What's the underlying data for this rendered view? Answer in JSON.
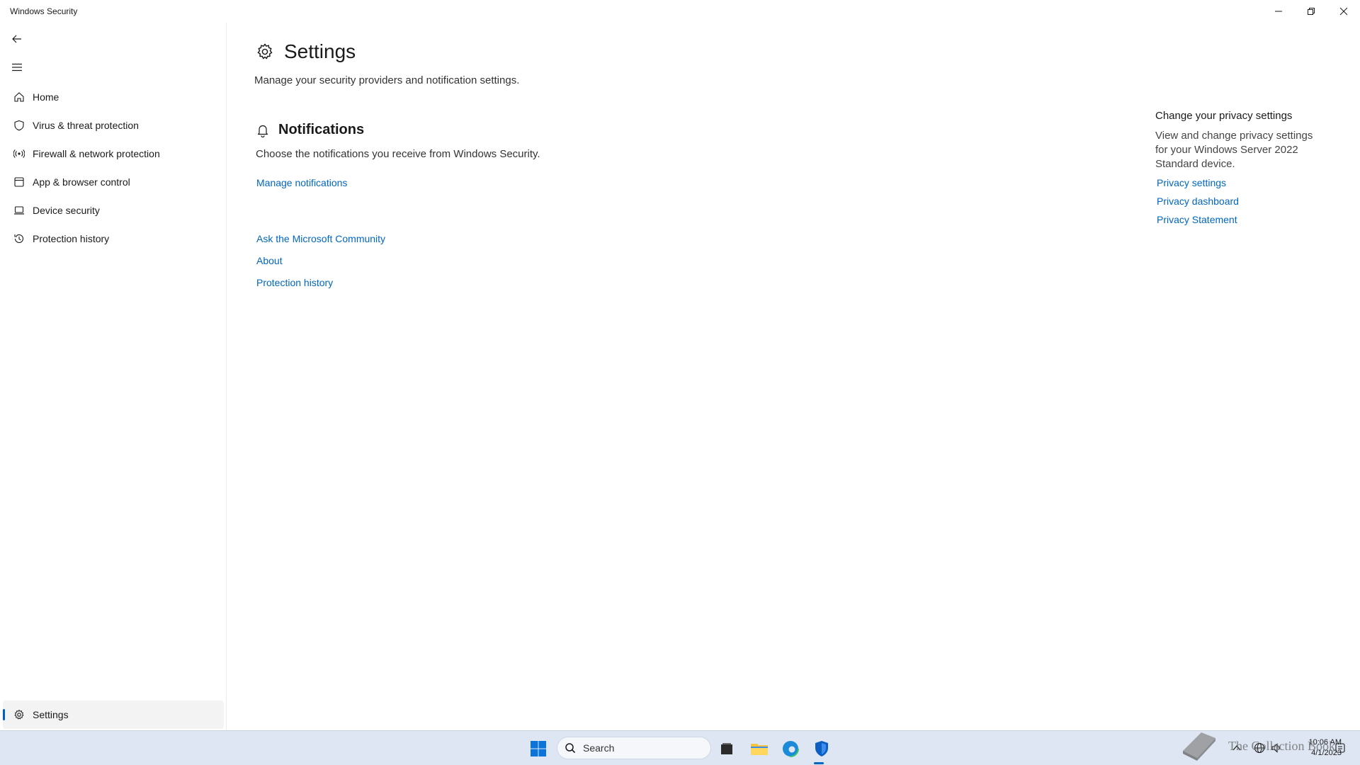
{
  "window": {
    "title": "Windows Security"
  },
  "sidebar": {
    "items": [
      {
        "label": "Home",
        "icon": "home-icon"
      },
      {
        "label": "Virus & threat protection",
        "icon": "shield-icon"
      },
      {
        "label": "Firewall & network protection",
        "icon": "antenna-icon"
      },
      {
        "label": "App & browser control",
        "icon": "browser-window-icon"
      },
      {
        "label": "Device security",
        "icon": "laptop-icon"
      },
      {
        "label": "Protection history",
        "icon": "history-icon"
      }
    ],
    "settings": {
      "label": "Settings",
      "icon": "gear-icon",
      "selected": true
    }
  },
  "page": {
    "title": "Settings",
    "subtitle": "Manage your security providers and notification settings."
  },
  "notifications": {
    "title": "Notifications",
    "description": "Choose the notifications you receive from Windows Security.",
    "manage_link": "Manage notifications"
  },
  "help_links": {
    "community": "Ask the Microsoft Community",
    "about": "About",
    "history": "Protection history"
  },
  "privacy": {
    "heading": "Change your privacy settings",
    "description": "View and change privacy settings for your Windows Server 2022 Standard device.",
    "links": [
      "Privacy settings",
      "Privacy dashboard",
      "Privacy Statement"
    ]
  },
  "taskbar": {
    "search_label": "Search",
    "time": "10:06 AM",
    "date": "4/1/2023",
    "watermark": "The Collection Book"
  },
  "colors": {
    "accent": "#0067c0",
    "taskbar": "#dde6f2",
    "selected_bg": "#f3f3f3"
  }
}
